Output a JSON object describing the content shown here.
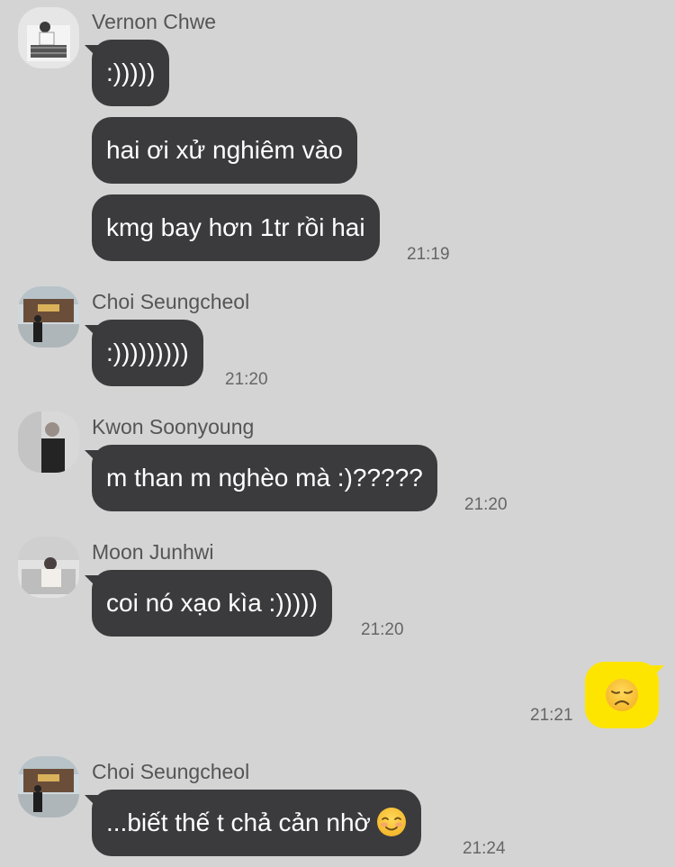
{
  "colors": {
    "background": "#d4d4d4",
    "incoming_bubble": "#3b3b3d",
    "outgoing_bubble": "#fee500",
    "incoming_text": "#ffffff"
  },
  "groups": [
    {
      "sender": "Vernon Chwe",
      "messages": [
        ":)))))",
        "hai ơi xử nghiêm vào",
        "kmg bay hơn 1tr rồi hai"
      ],
      "time": "21:19"
    },
    {
      "sender": "Choi Seungcheol",
      "messages": [
        ":)))))))))"
      ],
      "time": "21:20"
    },
    {
      "sender": "Kwon Soonyoung",
      "messages": [
        "m than m nghèo mà :)?????"
      ],
      "time": "21:20"
    },
    {
      "sender": "Moon Junhwi",
      "messages": [
        "coi nó xạo kìa :)))))"
      ],
      "time": "21:20"
    },
    {
      "sender": "Choi Seungcheol",
      "messages": [
        "...biết thế t chả cản nhờ"
      ],
      "emoji": "smiling-face-icon",
      "time": "21:24"
    }
  ],
  "outgoing": {
    "emoji": "disappointed-face-icon",
    "time": "21:21"
  }
}
